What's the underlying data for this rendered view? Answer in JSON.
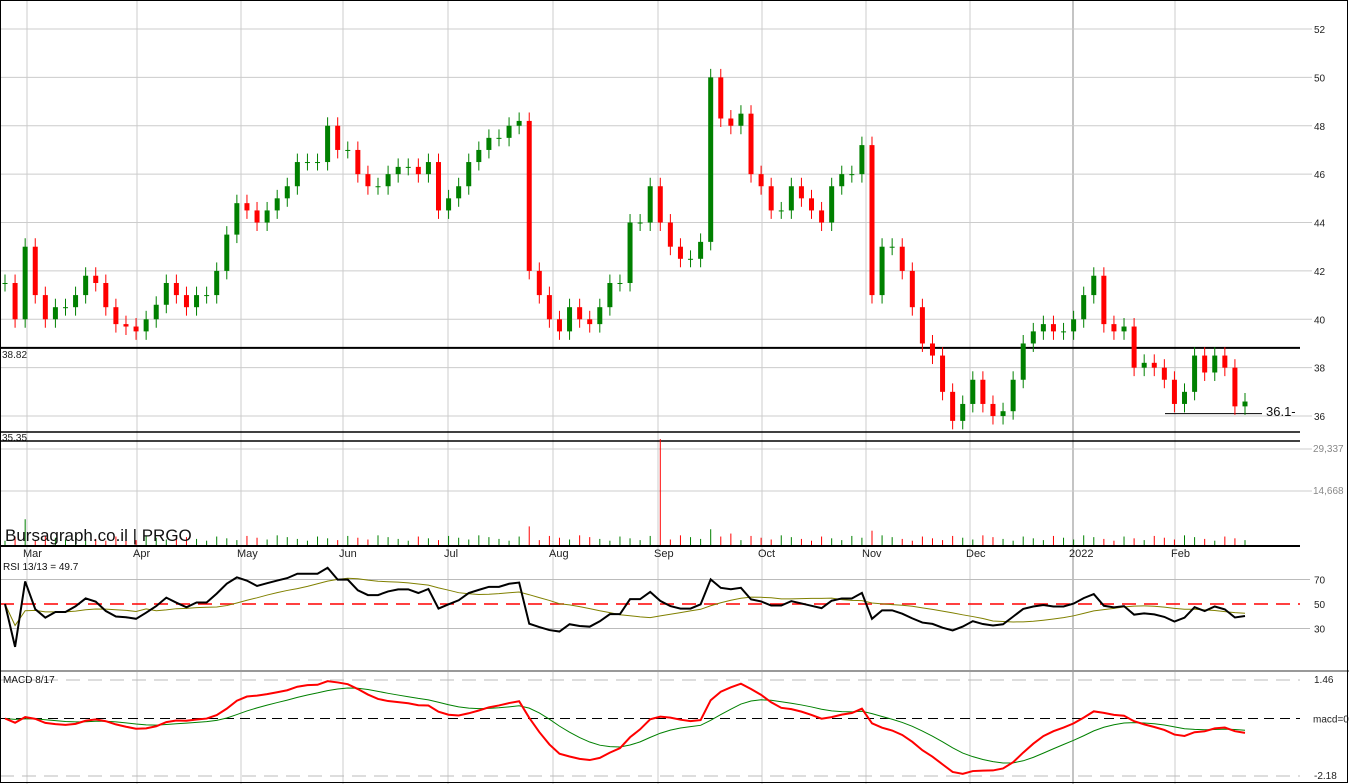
{
  "brand": "Bursagraph.co.il | PRGO",
  "rsi_title": "RSI 13/13 = 49.7",
  "macd_title": "MACD 8/17",
  "last_label": "36.1-",
  "colors": {
    "up": "#008000",
    "down": "#ff0000",
    "rsi": "#000000",
    "rsi_avg": "#808000",
    "macd": "#ff0000",
    "signal": "#008000"
  },
  "chart_data": {
    "type": "candlestick",
    "title": "PRGO",
    "x_ticks": [
      "Mar",
      "Apr",
      "May",
      "Jun",
      "Jul",
      "Aug",
      "Sep",
      "Oct",
      "Nov",
      "Dec",
      "2022",
      "Feb"
    ],
    "price_ticks": [
      "52",
      "50",
      "48",
      "46",
      "44",
      "42",
      "40",
      "38",
      "36"
    ],
    "ylim": [
      35.35,
      53
    ],
    "levels": [
      {
        "value": 38.82,
        "label": "38.82"
      },
      {
        "value": 35.35,
        "label": "35.35"
      }
    ],
    "support_line": 36.1,
    "closes": [
      41.5,
      40,
      43,
      41,
      40,
      40.5,
      40.5,
      41,
      41.8,
      41.5,
      40.5,
      39.8,
      39.7,
      39.5,
      40,
      40.6,
      41.5,
      41,
      40.5,
      41,
      41,
      42,
      43.5,
      44.8,
      44.5,
      44,
      44.5,
      45,
      45.5,
      46.5,
      46.5,
      46.5,
      48,
      47,
      47,
      46,
      45.5,
      45.5,
      46,
      46.3,
      46.3,
      46,
      46.5,
      44.5,
      45,
      45.5,
      46.5,
      47,
      47.5,
      47.5,
      48,
      48.2,
      42,
      41,
      40,
      39.5,
      40.5,
      40,
      39.8,
      40.5,
      41.5,
      41.5,
      44,
      44,
      45.5,
      44,
      43,
      42.5,
      42.5,
      43.2,
      50,
      48.3,
      48,
      48.5,
      46,
      45.5,
      44.5,
      44.5,
      45.5,
      45,
      44.5,
      44,
      45.5,
      46,
      46,
      47.2,
      41,
      43,
      43,
      42,
      40.5,
      39,
      38.5,
      37,
      35.8,
      36.5,
      37.5,
      36.5,
      36,
      36.2,
      37.5,
      39,
      39.5,
      39.8,
      39.5,
      39.5,
      40,
      41,
      41.8,
      39.8,
      39.5,
      39.7,
      38,
      38.2,
      38,
      37.5,
      36.5,
      37,
      38.5,
      37.8,
      38.5,
      38,
      36.4,
      36.6
    ],
    "volume_ticks": [
      "29,337",
      "14,668"
    ],
    "volume_base": 2500,
    "volume_spikes": [
      {
        "i": 2,
        "v": 9000
      },
      {
        "i": 52,
        "v": 6500
      },
      {
        "i": 65,
        "v": 37000
      },
      {
        "i": 70,
        "v": 5500
      },
      {
        "i": 86,
        "v": 5000
      },
      {
        "i": 72,
        "v": 4000
      }
    ],
    "rsi": {
      "period": 13,
      "avg_period": 13,
      "value": 49.7,
      "ticks": [
        "70",
        "50",
        "30"
      ],
      "levels": [
        70,
        50,
        30
      ]
    },
    "macd": {
      "fast": 8,
      "slow": 17,
      "signal": 9,
      "ticks": [
        "1.46",
        "macd=0",
        "-2.18"
      ],
      "range": [
        -2.18,
        1.46
      ]
    }
  }
}
